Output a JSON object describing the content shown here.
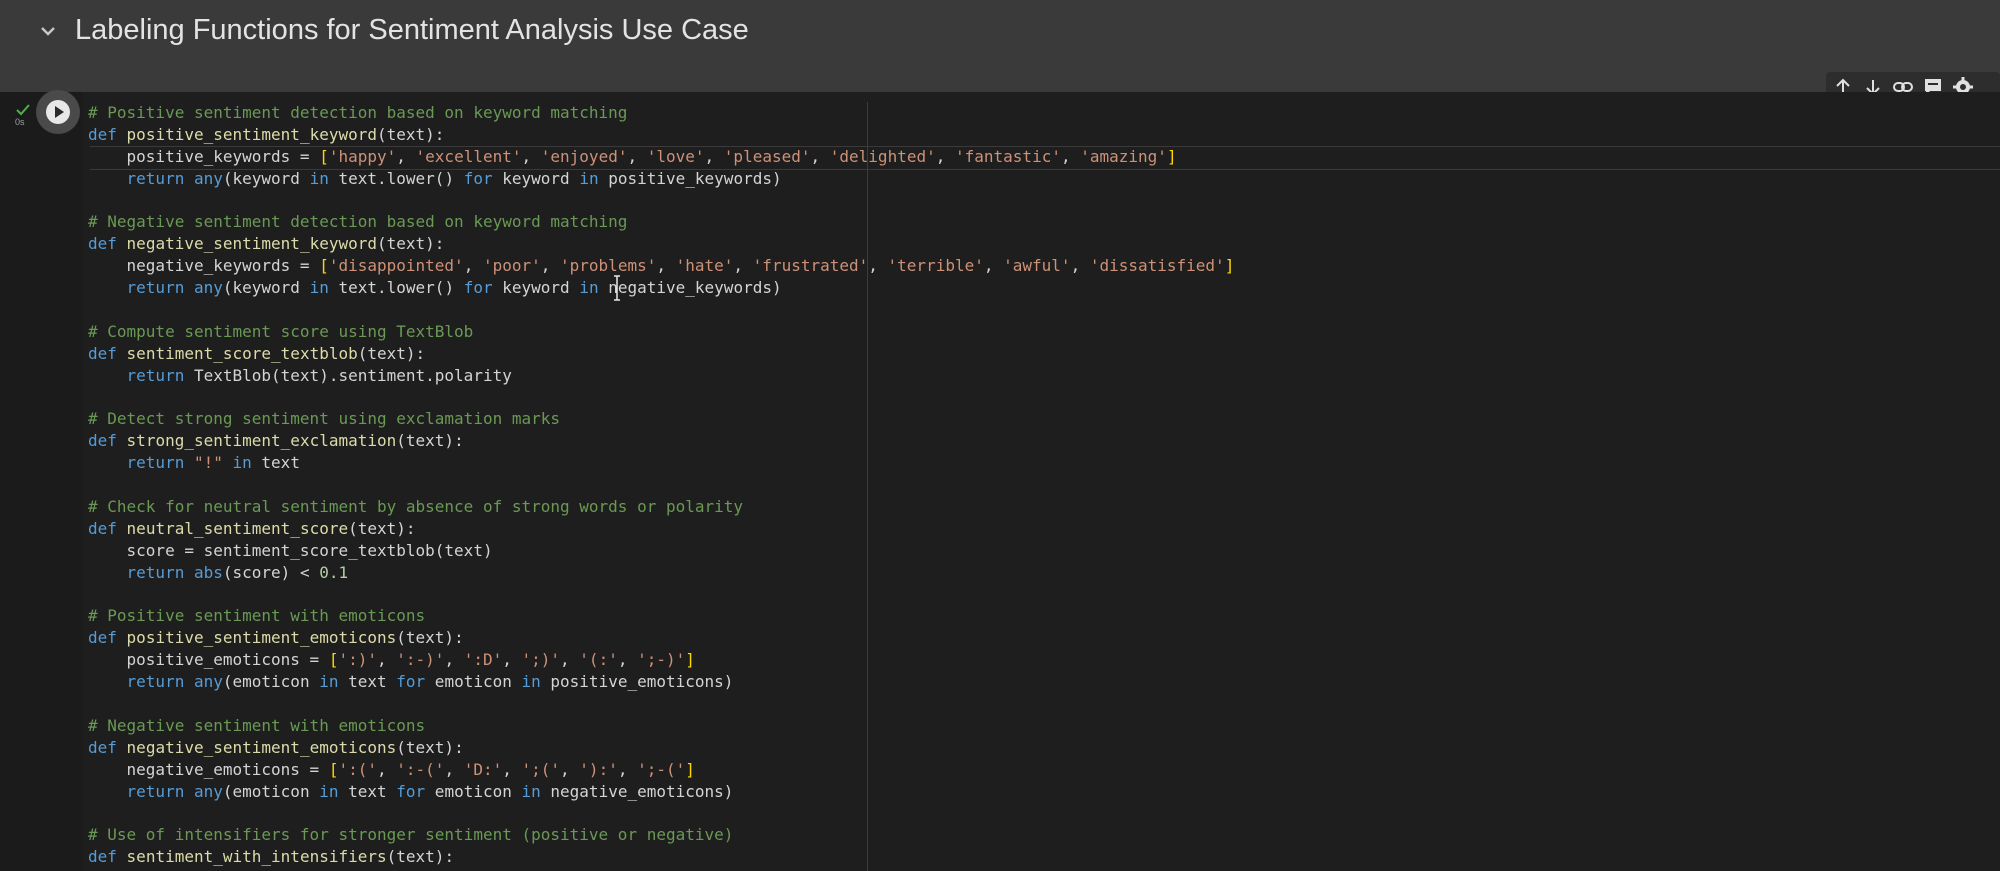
{
  "section": {
    "title": "Labeling Functions for Sentiment Analysis Use Case"
  },
  "cell": {
    "exec_time": "0s",
    "toolbar_icons": [
      "arrow-up-icon",
      "arrow-down-icon",
      "link-icon",
      "comment-icon",
      "gear-icon"
    ]
  },
  "code_lines": [
    "# Positive sentiment detection based on keyword matching",
    "def positive_sentiment_keyword(text):",
    "    positive_keywords = ['happy', 'excellent', 'enjoyed', 'love', 'pleased', 'delighted', 'fantastic', 'amazing']",
    "    return any(keyword in text.lower() for keyword in positive_keywords)",
    "",
    "# Negative sentiment detection based on keyword matching",
    "def negative_sentiment_keyword(text):",
    "    negative_keywords = ['disappointed', 'poor', 'problems', 'hate', 'frustrated', 'terrible', 'awful', 'dissatisfied']",
    "    return any(keyword in text.lower() for keyword in negative_keywords)",
    "",
    "# Compute sentiment score using TextBlob",
    "def sentiment_score_textblob(text):",
    "    return TextBlob(text).sentiment.polarity",
    "",
    "# Detect strong sentiment using exclamation marks",
    "def strong_sentiment_exclamation(text):",
    "    return \"!\" in text",
    "",
    "# Check for neutral sentiment by absence of strong words or polarity",
    "def neutral_sentiment_score(text):",
    "    score = sentiment_score_textblob(text)",
    "    return abs(score) < 0.1",
    "",
    "# Positive sentiment with emoticons",
    "def positive_sentiment_emoticons(text):",
    "    positive_emoticons = [':)', ':-)', ':D', ';)', '(:', ';-)']",
    "    return any(emoticon in text for emoticon in positive_emoticons)",
    "",
    "# Negative sentiment with emoticons",
    "def negative_sentiment_emoticons(text):",
    "    negative_emoticons = [':(', ':-(', 'D:', ';(', '):', ';-(']",
    "    return any(emoticon in text for emoticon in negative_emoticons)",
    "",
    "# Use of intensifiers for stronger sentiment (positive or negative)",
    "def sentiment_with_intensifiers(text):"
  ],
  "colors": {
    "comment": "#6a9955",
    "keyword": "#569cd6",
    "function": "#dcdcaa",
    "string": "#ce9178",
    "number": "#b5cea8",
    "bracket": "#ffd700"
  }
}
